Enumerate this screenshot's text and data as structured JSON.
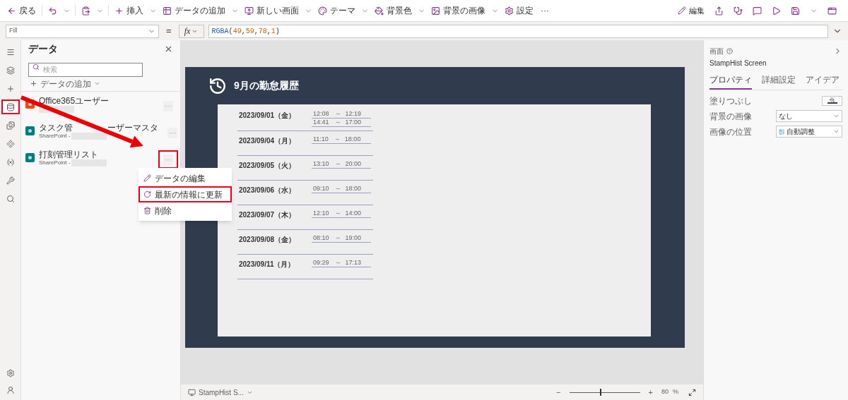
{
  "toolbar": {
    "left": [
      {
        "kind": "back",
        "label": "戻る",
        "caret": false
      },
      {
        "kind": "undo",
        "caret": true
      },
      {
        "kind": "paste",
        "caret": true
      },
      {
        "kind": "insert",
        "label": "挿入",
        "caret": true
      },
      {
        "kind": "add-data",
        "label": "データの追加",
        "caret": true
      },
      {
        "kind": "new-screen",
        "label": "新しい画面",
        "caret": true
      },
      {
        "kind": "theme",
        "label": "テーマ",
        "caret": true
      },
      {
        "kind": "bg-color",
        "label": "背景色",
        "caret": true
      },
      {
        "kind": "bg-image",
        "label": "背景の画像",
        "caret": true
      },
      {
        "kind": "settings",
        "label": "設定",
        "caret": false
      },
      {
        "kind": "more",
        "label": "···",
        "caret": false
      }
    ],
    "edit_label": "編集"
  },
  "formula_bar": {
    "property": "Fill",
    "equals": "=",
    "fx": "fx",
    "tokens": [
      {
        "kind": "fn",
        "text": "RGBA"
      },
      {
        "kind": "punct",
        "text": "("
      },
      {
        "kind": "num",
        "text": "49"
      },
      {
        "kind": "punct",
        "text": ","
      },
      {
        "kind": "num",
        "text": "59"
      },
      {
        "kind": "punct",
        "text": ","
      },
      {
        "kind": "num",
        "text": "78"
      },
      {
        "kind": "punct",
        "text": ","
      },
      {
        "kind": "num",
        "text": "1"
      },
      {
        "kind": "punct",
        "text": ")"
      }
    ]
  },
  "rail": [
    {
      "highlighted": false
    },
    {
      "highlighted": false
    },
    {
      "highlighted": false
    },
    {
      "highlighted": true
    },
    {
      "highlighted": false
    },
    {
      "highlighted": false
    },
    {
      "highlighted": false
    },
    {
      "highlighted": false
    },
    {
      "highlighted": false
    }
  ],
  "data_panel": {
    "title": "データ",
    "search": {
      "placeholder": "検索"
    },
    "add_label": "データの追加",
    "sources": [
      {
        "kind": "office",
        "name_parts": [
          "Office365ユーザー"
        ],
        "highlighted": false
      },
      {
        "kind": "sharepoint",
        "name_parts": [
          "タスク管",
          "ーザーマスタ"
        ],
        "subtitle": "SharePoint -",
        "highlighted": false
      },
      {
        "kind": "sharepoint",
        "name_parts": [
          "打刻管理リスト"
        ],
        "subtitle": "SharePoint -",
        "highlighted": true
      }
    ],
    "more": "···",
    "menu": [
      {
        "kind": "edit",
        "label": "データの編集",
        "highlighted": false
      },
      {
        "kind": "refresh",
        "label": "最新の情報に更新",
        "highlighted": true
      },
      {
        "kind": "delete",
        "label": "削除",
        "highlighted": false
      }
    ]
  },
  "app_screen": {
    "title": "9月の勤怠履歴",
    "color": "#313b4e",
    "rows": [
      {
        "date": "2023/09/01（金）",
        "times": [
          {
            "start": "12:08",
            "sep": "～",
            "end": "12:19"
          },
          {
            "start": "14:41",
            "sep": "～",
            "end": "17:00"
          }
        ]
      },
      {
        "date": "2023/09/04（月）",
        "times": [
          {
            "start": "11:10",
            "sep": "～",
            "end": "18:00"
          }
        ]
      },
      {
        "date": "2023/09/05（火）",
        "times": [
          {
            "start": "13:10",
            "sep": "～",
            "end": "20:00"
          }
        ]
      },
      {
        "date": "2023/09/06（水）",
        "times": [
          {
            "start": "09:10",
            "sep": "～",
            "end": "18:00"
          }
        ]
      },
      {
        "date": "2023/09/07（木）",
        "times": [
          {
            "start": "12:10",
            "sep": "～",
            "end": "14:00"
          }
        ]
      },
      {
        "date": "2023/09/08（金）",
        "times": [
          {
            "start": "08:10",
            "sep": "～",
            "end": "19:00"
          }
        ]
      },
      {
        "date": "2023/09/11（月）",
        "times": [
          {
            "start": "09:29",
            "sep": "～",
            "end": "17:13"
          }
        ]
      }
    ]
  },
  "status_bar": {
    "screen": "StampHist S...",
    "zoom": {
      "level": 0.43,
      "value": "80",
      "unit": "%"
    },
    "minus": "−",
    "plus": "+"
  },
  "properties": {
    "heading": "画面",
    "screen_name": "StampHist Screen",
    "tabs": [
      {
        "label": "プロパティ",
        "selected": true
      },
      {
        "label": "詳細設定",
        "selected": false
      },
      {
        "label": "アイデア",
        "selected": false
      }
    ],
    "rows": [
      {
        "kind": "color",
        "label": "塗りつぶし"
      },
      {
        "kind": "dropdown",
        "label": "背景の画像",
        "value": "なし"
      },
      {
        "kind": "image-dropdown",
        "label": "画像の位置",
        "value": "自動調整"
      }
    ]
  }
}
